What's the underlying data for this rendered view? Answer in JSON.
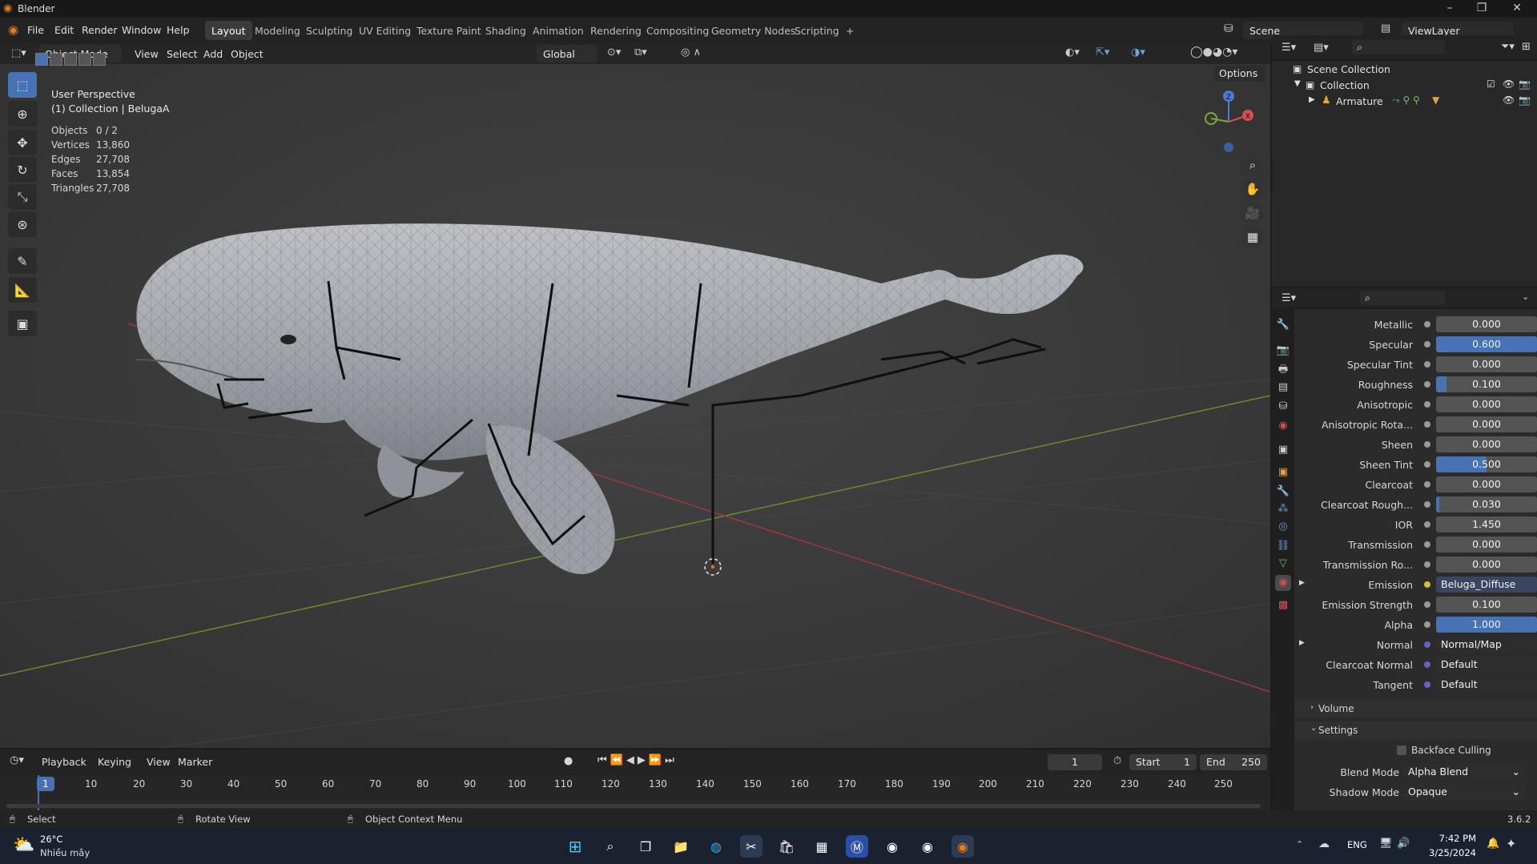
{
  "window": {
    "title": "Blender",
    "controls": [
      "–",
      "❐",
      "✕"
    ]
  },
  "menu": [
    "File",
    "Edit",
    "Render",
    "Window",
    "Help"
  ],
  "workspaces": [
    "Layout",
    "Modeling",
    "Sculpting",
    "UV Editing",
    "Texture Paint",
    "Shading",
    "Animation",
    "Rendering",
    "Compositing",
    "Geometry Nodes",
    "Scripting"
  ],
  "active_workspace": "Layout",
  "scene": {
    "name": "Scene",
    "view_layer": "ViewLayer"
  },
  "viewport": {
    "mode": "Object Mode",
    "menus": [
      "View",
      "Select",
      "Add",
      "Object"
    ],
    "orientation": "Global",
    "options_label": "Options",
    "perspective": "User Perspective",
    "collection_info": "(1) Collection | BelugaA",
    "stats": [
      {
        "label": "Objects",
        "value": "0 / 2"
      },
      {
        "label": "Vertices",
        "value": "13,860"
      },
      {
        "label": "Edges",
        "value": "27,708"
      },
      {
        "label": "Faces",
        "value": "13,854"
      },
      {
        "label": "Triangles",
        "value": "27,708"
      }
    ],
    "gizmo": {
      "z": "Z",
      "y": "Y",
      "x": "X"
    }
  },
  "outliner": {
    "scene_collection": "Scene Collection",
    "collection": "Collection",
    "armature": "Armature"
  },
  "properties": {
    "rows": [
      {
        "label": "Metallic",
        "value": "0.000",
        "fill": 0
      },
      {
        "label": "Specular",
        "value": "0.600",
        "fill": 1.0
      },
      {
        "label": "Specular Tint",
        "value": "0.000",
        "fill": 0
      },
      {
        "label": "Roughness",
        "value": "0.100",
        "fill": 0.1
      },
      {
        "label": "Anisotropic",
        "value": "0.000",
        "fill": 0
      },
      {
        "label": "Anisotropic Rota...",
        "value": "0.000",
        "fill": 0
      },
      {
        "label": "Sheen",
        "value": "0.000",
        "fill": 0
      },
      {
        "label": "Sheen Tint",
        "value": "0.500",
        "fill": 0.5
      },
      {
        "label": "Clearcoat",
        "value": "0.000",
        "fill": 0
      },
      {
        "label": "Clearcoat Rough...",
        "value": "0.030",
        "fill": 0.03
      },
      {
        "label": "IOR",
        "value": "1.450",
        "fill": 0
      },
      {
        "label": "Transmission",
        "value": "0.000",
        "fill": 0
      },
      {
        "label": "Transmission Ro...",
        "value": "0.000",
        "fill": 0
      },
      {
        "label": "Emission",
        "value": "Beluga_Diffuse",
        "link": true,
        "dot": "#c7c729"
      },
      {
        "label": "Emission Strength",
        "value": "0.100",
        "fill": 0
      },
      {
        "label": "Alpha",
        "value": "1.000",
        "fill": 1.0
      },
      {
        "label": "Normal",
        "value": "Normal/Map",
        "link": true,
        "dot": "#6363c7"
      },
      {
        "label": "Clearcoat Normal",
        "value": "Default",
        "link": true,
        "dot": "#6363c7"
      },
      {
        "label": "Tangent",
        "value": "Default",
        "link": true,
        "dot": "#6363c7"
      }
    ],
    "volume": "Volume",
    "settings": "Settings",
    "backface_culling": "Backface Culling",
    "blend_mode": {
      "label": "Blend Mode",
      "value": "Alpha Blend"
    },
    "shadow_mode": {
      "label": "Shadow Mode",
      "value": "Opaque"
    }
  },
  "timeline": {
    "menus": [
      "Playback",
      "Keying",
      "View",
      "Marker"
    ],
    "current_frame": "1",
    "start_label": "Start",
    "start": "1",
    "end_label": "End",
    "end": "250",
    "ticks": [
      "1",
      "10",
      "20",
      "30",
      "40",
      "50",
      "60",
      "70",
      "80",
      "90",
      "100",
      "110",
      "120",
      "130",
      "140",
      "150",
      "160",
      "170",
      "180",
      "190",
      "200",
      "210",
      "220",
      "230",
      "240",
      "250"
    ]
  },
  "status": {
    "select": "Select",
    "rotate": "Rotate View",
    "context": "Object Context Menu",
    "version": "3.6.2"
  },
  "taskbar": {
    "weather_temp": "26°C",
    "weather_desc": "Nhiều mây",
    "lang": "ENG",
    "time": "7:42 PM",
    "date": "3/25/2024"
  }
}
